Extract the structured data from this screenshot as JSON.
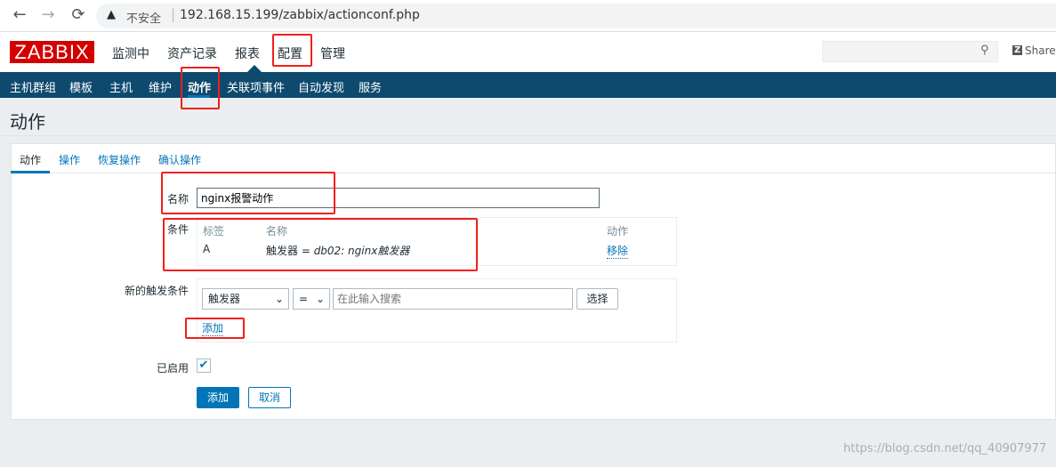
{
  "browser": {
    "back": "←",
    "forward": "→",
    "reload": "⟳",
    "security": "不安全",
    "url": "192.168.15.199/zabbix/actionconf.php"
  },
  "header": {
    "logo": "ZABBIX",
    "menu": [
      "监测中",
      "资产记录",
      "报表",
      "配置",
      "管理"
    ],
    "share": "Share"
  },
  "subnav": [
    "主机群组",
    "模板",
    "主机",
    "维护",
    "动作",
    "关联项事件",
    "自动发现",
    "服务"
  ],
  "page_title": "动作",
  "tabs": [
    "动作",
    "操作",
    "恢复操作",
    "确认操作"
  ],
  "form": {
    "name_label": "名称",
    "name_value": "nginx报警动作",
    "conditions_label": "条件",
    "conditions_headers": {
      "label": "标签",
      "name": "名称",
      "action": "动作"
    },
    "conditions": [
      {
        "label": "A",
        "name_prefix": "触发器 = ",
        "name_value": "db02: nginx触发器",
        "action": "移除"
      }
    ],
    "new_condition_label": "新的触发条件",
    "condition_type": "触发器",
    "operator": "=",
    "search_placeholder": "在此输入搜索",
    "select_button": "选择",
    "add_link": "添加",
    "enabled_label": "已启用",
    "enabled": true,
    "submit": "添加",
    "cancel": "取消"
  },
  "watermark": "https://blog.csdn.net/qq_40907977",
  "colors": {
    "brand": "#d40000",
    "nav": "#0e4a6e",
    "link": "#0275b8",
    "annotation": "#f0201a"
  }
}
